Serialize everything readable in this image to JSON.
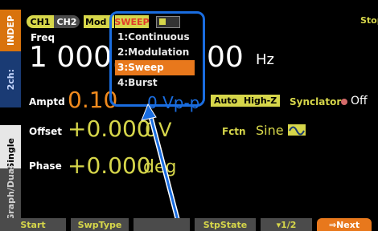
{
  "left_tabs": {
    "indep": "INDEP",
    "two_ch": "2ch:",
    "single": "Single",
    "graph_dual": "Graph/Dual"
  },
  "header": {
    "ch1": "CH1",
    "ch2": "CH2",
    "mode_tab": "Mod",
    "mode_value": "SWEEP",
    "status": "Stop"
  },
  "freq": {
    "label": "Freq",
    "value_left": "1 000.",
    "value_right": "00",
    "unit": "Hz"
  },
  "amptd": {
    "label": "Amptd",
    "value": "0.10",
    "unit": "0 Vp-p",
    "auto": "Auto",
    "highz": "High-Z"
  },
  "synclator": {
    "label": "Synclator",
    "state": "Off"
  },
  "offset": {
    "label": "Offset",
    "value": "+0.000",
    "unit_hidden": "0",
    "unit": "V"
  },
  "fctn": {
    "label": "Fctn",
    "value": "Sine"
  },
  "phase": {
    "label": "Phase",
    "value": "+0.000",
    "unit": "deg"
  },
  "popup": {
    "items": [
      {
        "label": "1:Continuous"
      },
      {
        "label": "2:Modulation"
      },
      {
        "label": "3:Sweep",
        "selected": true
      },
      {
        "label": "4:Burst"
      }
    ]
  },
  "softkeys": [
    "Start",
    "SwpType",
    "",
    "StpState",
    "▾1/2",
    "⇒Next"
  ],
  "colors": {
    "accent_orange": "#e8781c",
    "yellow": "#d6d64a",
    "highlight_blue": "#1a6de0"
  }
}
